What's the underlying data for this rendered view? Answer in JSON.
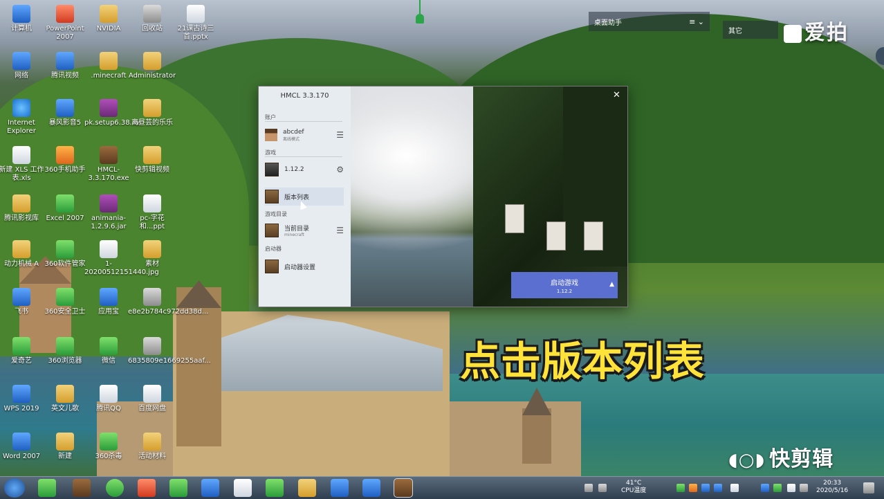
{
  "desktop_icons": [
    {
      "label": "计算机",
      "glyph": "computer-icon",
      "color": "blue"
    },
    {
      "label": "PowerPoint 2007",
      "glyph": "powerpoint-icon",
      "color": "red"
    },
    {
      "label": "NVIDIA",
      "glyph": "folder-icon",
      "color": "folder"
    },
    {
      "label": "回收站",
      "glyph": "recycle-bin-icon",
      "color": "grey"
    },
    {
      "label": "21课古诗三首.pptx",
      "glyph": "pptx-file-icon",
      "color": "white"
    },
    {
      "label": "网络",
      "glyph": "network-icon",
      "color": "blue"
    },
    {
      "label": "腾讯视频",
      "glyph": "tencent-video-icon",
      "color": "blue"
    },
    {
      "label": ".minecraft",
      "glyph": "folder-icon",
      "color": "folder"
    },
    {
      "label": "Administrator",
      "glyph": "folder-icon",
      "color": "folder"
    },
    {
      "label": "Internet Explorer",
      "glyph": "ie-icon",
      "color": "ie"
    },
    {
      "label": "暴风影音5",
      "glyph": "baofeng-icon",
      "color": "blue"
    },
    {
      "label": "pk.setup6.38.rar",
      "glyph": "rar-icon",
      "color": "rar"
    },
    {
      "label": "离昼芸的乐乐",
      "glyph": "folder-icon",
      "color": "folder"
    },
    {
      "label": "新建 XLS 工作表.xls",
      "glyph": "xls-file-icon",
      "color": "white"
    },
    {
      "label": "360手机助手",
      "glyph": "phone-assistant-icon",
      "color": "orange"
    },
    {
      "label": "HMCL-3.3.170.exe",
      "glyph": "minecraft-block-icon",
      "color": "brown"
    },
    {
      "label": "快剪辑视频",
      "glyph": "folder-icon",
      "color": "folder"
    },
    {
      "label": "腾讯影视库",
      "glyph": "folder-icon",
      "color": "folder"
    },
    {
      "label": "Excel 2007",
      "glyph": "excel-icon",
      "color": "green"
    },
    {
      "label": "animania-1.2.9.6.jar",
      "glyph": "rar-icon",
      "color": "rar"
    },
    {
      "label": "pc-字花和...ppt",
      "glyph": "ppt-file-icon",
      "color": "white"
    },
    {
      "label": "动力机械 A",
      "glyph": "folder-icon",
      "color": "folder"
    },
    {
      "label": "360软件管家",
      "glyph": "software-manager-icon",
      "color": "green"
    },
    {
      "label": "1-20200512151440.jpg",
      "glyph": "image-file-icon",
      "color": "white"
    },
    {
      "label": "素材",
      "glyph": "folder-icon",
      "color": "folder"
    },
    {
      "label": "飞书",
      "glyph": "feishu-icon",
      "color": "blue"
    },
    {
      "label": "360安全卫士",
      "glyph": "shield-icon",
      "color": "green"
    },
    {
      "label": "应用宝",
      "glyph": "app-store-icon",
      "color": "blue"
    },
    {
      "label": "e8e2b784c972dd38d...",
      "glyph": "file-icon",
      "color": "grey"
    },
    {
      "label": "爱奇艺",
      "glyph": "iqiyi-icon",
      "color": "green"
    },
    {
      "label": "360浏览器",
      "glyph": "browser-icon",
      "color": "green"
    },
    {
      "label": "微信",
      "glyph": "wechat-icon",
      "color": "green"
    },
    {
      "label": "6835809e1669255aaf...",
      "glyph": "file-icon",
      "color": "grey"
    },
    {
      "label": "WPS 2019",
      "glyph": "wps-icon",
      "color": "blue"
    },
    {
      "label": "英文儿歌",
      "glyph": "folder-icon",
      "color": "folder"
    },
    {
      "label": "腾讯QQ",
      "glyph": "qq-icon",
      "color": "white"
    },
    {
      "label": "百度网盘",
      "glyph": "cloud-drive-icon",
      "color": "white"
    },
    {
      "label": "Word 2007",
      "glyph": "word-icon",
      "color": "blue"
    },
    {
      "label": "新建",
      "glyph": "folder-icon",
      "color": "folder"
    },
    {
      "label": "360杀毒",
      "glyph": "antivirus-icon",
      "color": "green"
    },
    {
      "label": "活动材料",
      "glyph": "folder-icon",
      "color": "folder"
    }
  ],
  "widgets": {
    "assistant_label": "桌面助手",
    "assistant_menu": "≡ ⌄",
    "other_label": "其它",
    "aipai_brand": "爱拍"
  },
  "hmcl": {
    "title": "HMCL 3.3.170",
    "section_account": "账户",
    "account_name": "abcdef",
    "account_type": "离线模式",
    "section_game": "游戏",
    "game_version": "1.12.2",
    "version_list": "版本列表",
    "section_game_dir": "游戏目录",
    "current_dir": "当前目录",
    "current_dir_sub": "minecraft",
    "section_launcher": "启动器",
    "launcher_settings": "启动器设置",
    "close": "✕",
    "launch_label": "启动游戏",
    "launch_version": "1.12.2",
    "launch_arrow": "▲"
  },
  "subtitle": "点击版本列表",
  "watermark": "快剪辑",
  "taskbar": {
    "cpu_temp": "41°C",
    "cpu_label": "CPU温度",
    "time": "20:33",
    "date": "2020/5/16"
  },
  "colors": {
    "accent_launch": "#5b6fd1",
    "subtitle_yellow": "#ffe23a"
  }
}
